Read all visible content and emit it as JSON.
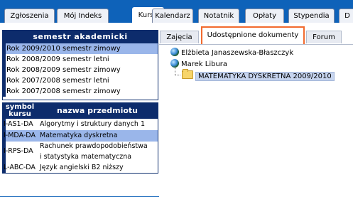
{
  "top_tabs": [
    {
      "label": "Zgłoszenia"
    },
    {
      "label": "Mój Indeks"
    },
    {
      "label": "Kursy",
      "active": true
    },
    {
      "label": "Kalendarz"
    },
    {
      "label": "Notatnik"
    },
    {
      "label": "Opłaty"
    },
    {
      "label": "Stypendia"
    },
    {
      "label": "D"
    }
  ],
  "semesters": {
    "header": "semestr akademicki",
    "items": [
      {
        "label": "Rok 2009/2010 semestr zimowy",
        "selected": true
      },
      {
        "label": "Rok 2008/2009 semestr letni"
      },
      {
        "label": "Rok 2008/2009 semestr zimowy"
      },
      {
        "label": "Rok 2007/2008 semestr letni"
      },
      {
        "label": "Rok 2007/2008 semestr zimowy"
      }
    ]
  },
  "courses": {
    "header_code_line1": "symbol",
    "header_code_line2": "kursu",
    "header_name": "nazwa przedmiotu",
    "rows": [
      {
        "code": "I-AS1-DA",
        "name": "Algorytmy i struktury danych 1"
      },
      {
        "code": "I-MDA-DA",
        "name": "Matematyka dyskretna",
        "selected": true
      },
      {
        "code": "I-RPS-DA",
        "name_line1": "Rachunek prawdopodobieństwa",
        "name_line2": "i statystyka matematyczna"
      },
      {
        "code": "L-ABC-DA",
        "name": "Język angielski B2 niższy"
      }
    ]
  },
  "sub_tabs": [
    {
      "label": "Zajęcia"
    },
    {
      "label": "Udostępnione dokumenty",
      "active": true
    },
    {
      "label": "Forum"
    }
  ],
  "tree": {
    "people": [
      "Elżbieta Janaszewska-Błaszczyk",
      "Marek Libura"
    ],
    "folder": "MATEMATYKA DYSKRETNA 2009/2010"
  },
  "colors": {
    "accent": "#0e62b9",
    "header": "#0d2c6c",
    "selection": "#9ab6ea",
    "highlight": "#f26a2e"
  }
}
